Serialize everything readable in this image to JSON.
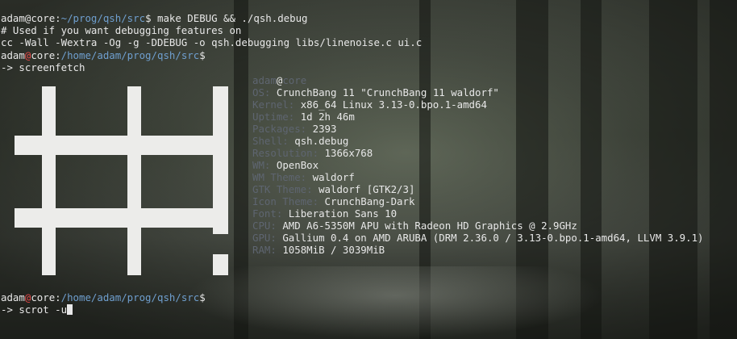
{
  "prompt": {
    "user": "adam",
    "host": "core",
    "path_tilde": "~/prog/qsh/src",
    "path_full": "/home/adam/prog/qsh/src",
    "dollar": "$",
    "arrow": "->"
  },
  "lines": {
    "cmd1": "make DEBUG && ./qsh.debug",
    "out1": "# Used if you want debugging features on",
    "out2": "cc -Wall -Wextra -Og -g -DDEBUG -o qsh.debugging libs/linenoise.c ui.c",
    "cmd2": "screenfetch",
    "cmd3": "scrot -u"
  },
  "screenfetch": {
    "user": "adam",
    "at": "@",
    "host": "core",
    "rows": [
      {
        "key": "OS:",
        "value": "CrunchBang 11 \"CrunchBang 11 waldorf\""
      },
      {
        "key": "Kernel:",
        "value": "x86_64 Linux 3.13-0.bpo.1-amd64"
      },
      {
        "key": "Uptime:",
        "value": "1d 2h 46m"
      },
      {
        "key": "Packages:",
        "value": "2393"
      },
      {
        "key": "Shell:",
        "value": "qsh.debug"
      },
      {
        "key": "Resolution:",
        "value": "1366x768"
      },
      {
        "key": "WM:",
        "value": "OpenBox"
      },
      {
        "key": "WM Theme:",
        "value": "waldorf"
      },
      {
        "key": "GTK Theme:",
        "value": "waldorf [GTK2/3]"
      },
      {
        "key": "Icon Theme:",
        "value": "CrunchBang-Dark"
      },
      {
        "key": "Font:",
        "value": "Liberation Sans 10"
      },
      {
        "key": "CPU:",
        "value": "AMD A6-5350M APU with Radeon HD Graphics @ 2.9GHz"
      },
      {
        "key": "GPU:",
        "value": "Gallium 0.4 on AMD ARUBA (DRM 2.36.0 / 3.13-0.bpo.1-amd64, LLVM 3.9.1)"
      },
      {
        "key": "RAM:",
        "value": "1058MiB / 3039MiB"
      }
    ]
  },
  "colors": {
    "text": "#e8e8e8",
    "at_sign": "#e84848",
    "path": "#6f9fcf",
    "key": "#5e6570",
    "logo": "#ececea"
  },
  "logo_text": "#!"
}
